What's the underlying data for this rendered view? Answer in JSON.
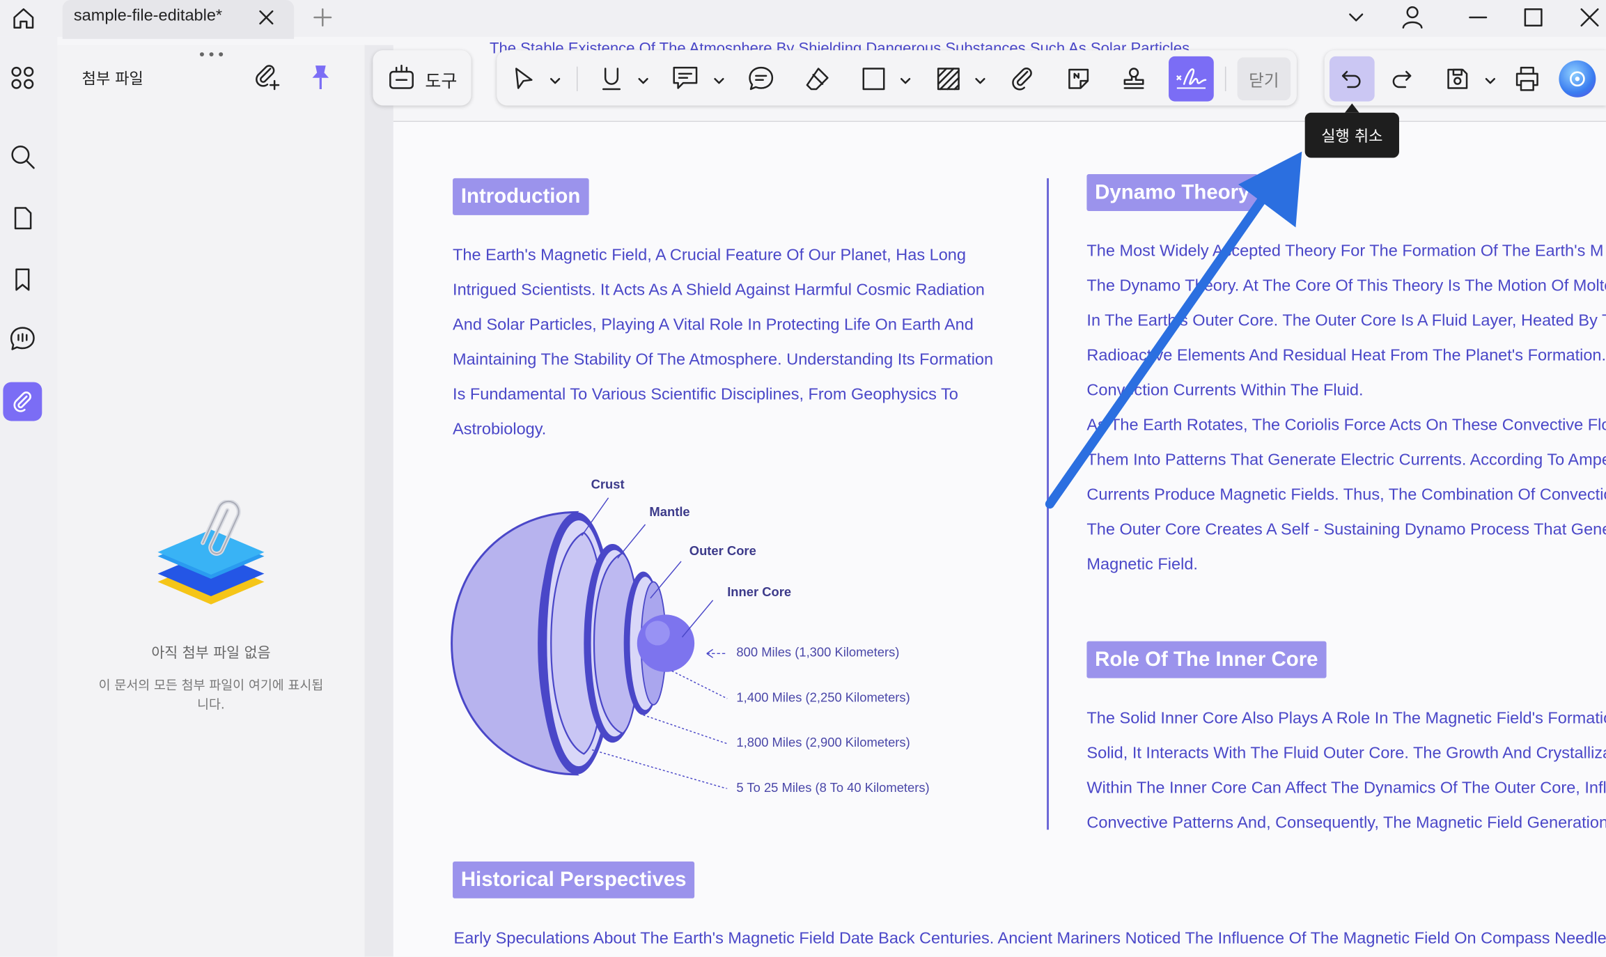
{
  "app": {
    "tab_title": "sample-file-editable*",
    "accent_color": "#7b6df5"
  },
  "sidebar": {
    "title": "첨부 파일",
    "empty_title": "아직 첨부 파일 없음",
    "empty_desc": "이 문서의 모든 첨부 파일이 여기에 표시됩니다."
  },
  "toolbar": {
    "tools_label": "도구",
    "close_label": "닫기",
    "undo_tooltip": "실행 취소"
  },
  "document": {
    "top_line": "The Stable Existence Of The Atmosphere By Shielding Dangerous Substances Such As Solar Particles",
    "intro": {
      "heading": "Introduction",
      "lines": [
        "The Earth's Magnetic Field, A Crucial Feature Of Our Planet, Has Long",
        "Intrigued Scientists. It Acts As A Shield Against Harmful Cosmic Radiation",
        "And Solar Particles, Playing A Vital Role In Protecting Life On Earth And",
        "Maintaining The Stability Of The Atmosphere. Understanding Its Formation",
        "Is Fundamental To Various Scientific Disciplines, From Geophysics To",
        "Astrobiology."
      ]
    },
    "diagram": {
      "layers": [
        "Crust",
        "Mantle",
        "Outer Core",
        "Inner Core"
      ],
      "dimensions": [
        "800 Miles (1,300 Kilometers)",
        "1,400 Miles (2,250 Kilometers)",
        "1,800 Miles (2,900 Kilometers)",
        "5 To 25 Miles (8 To 40 Kilometers)"
      ]
    },
    "dynamo": {
      "heading": "Dynamo Theory",
      "lines": [
        "The Most Widely Accepted Theory For The Formation Of The Earth's M",
        "The Dynamo Theory. At The Core Of This Theory Is The Motion Of Molte",
        "In The Earth's Outer Core. The Outer Core Is A Fluid Layer, Heated By T",
        "Radioactive Elements And Residual Heat From The Planet's Formation.",
        "Convection Currents Within The Fluid.",
        "As The Earth Rotates, The Coriolis Force Acts On These Convective Flo",
        "Them Into Patterns That Generate Electric Currents. According To Ampe",
        "Currents Produce Magnetic Fields. Thus, The Combination Of Convectio",
        "The Outer Core Creates A Self - Sustaining Dynamo Process That Gene",
        "Magnetic Field."
      ]
    },
    "inner_core": {
      "heading": "Role Of The Inner Core",
      "lines": [
        "The Solid Inner Core Also Plays A Role In The Magnetic Field's Formatio",
        "Solid, It Interacts With The Fluid Outer Core. The Growth And Crystalliza",
        "Within The Inner Core Can Affect The Dynamics Of The Outer Core, Influ",
        "Convective Patterns And, Consequently, The Magnetic Field Generation"
      ]
    },
    "history": {
      "heading": "Historical Perspectives",
      "line": "Early Speculations About The Earth's Magnetic Field Date Back Centuries. Ancient Mariners Noticed The Influence Of The Magnetic Field On Compass Needles"
    }
  }
}
